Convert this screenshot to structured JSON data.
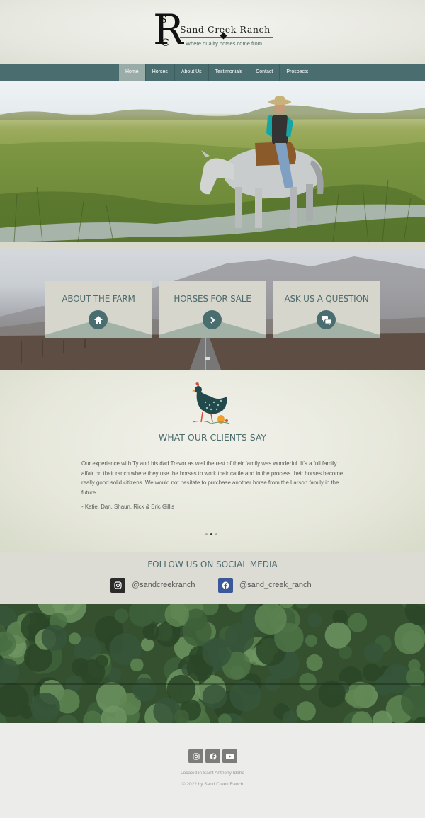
{
  "brand": {
    "monogram": "SRC",
    "name": "Sand Creek Ranch",
    "tagline": "Where quality horses come from"
  },
  "nav": {
    "items": [
      {
        "label": "Home",
        "active": true
      },
      {
        "label": "Horses"
      },
      {
        "label": "About Us"
      },
      {
        "label": "Testimonials"
      },
      {
        "label": "Contact"
      },
      {
        "label": "Prospects"
      }
    ]
  },
  "cards": [
    {
      "title": "ABOUT THE FARM",
      "icon": "house-icon"
    },
    {
      "title": "HORSES FOR SALE",
      "icon": "chevron-right-icon"
    },
    {
      "title": "ASK US A QUESTION",
      "icon": "chat-icon"
    }
  ],
  "testimonials": {
    "heading": "WHAT OUR CLIENTS SAY",
    "quote": "Our experience with Ty and his dad Trevor as well the rest of their family was wonderful. It's a full family affair on their ranch where they use the horses to work their cattle and in the process their horses become really good solid citizens. We would not hesitate to purchase another horse from the Larson family in the future.",
    "author": "- Katie, Dan, Shaun, Rick & Eric Gillis",
    "slides": 3,
    "active_slide": 2
  },
  "social": {
    "heading": "FOLLOW US ON SOCIAL MEDIA",
    "instagram": {
      "handle": "@sandcreekranch",
      "icon": "instagram-icon",
      "color": "#2b2b2b"
    },
    "facebook": {
      "handle": "@sand_creek_ranch",
      "icon": "facebook-icon",
      "color": "#3b5998"
    }
  },
  "footer": {
    "icons": [
      "instagram-icon",
      "facebook-icon",
      "youtube-icon"
    ],
    "location": "Located in Saint Anthony Idaho",
    "copyright": "© 2022 by Sand Creek Ranch"
  },
  "colors": {
    "teal": "#4a6e70",
    "nav_active": "#9aaca8",
    "card_bg": "#d6d6cd",
    "card_wedge": "#a3b2a6"
  }
}
